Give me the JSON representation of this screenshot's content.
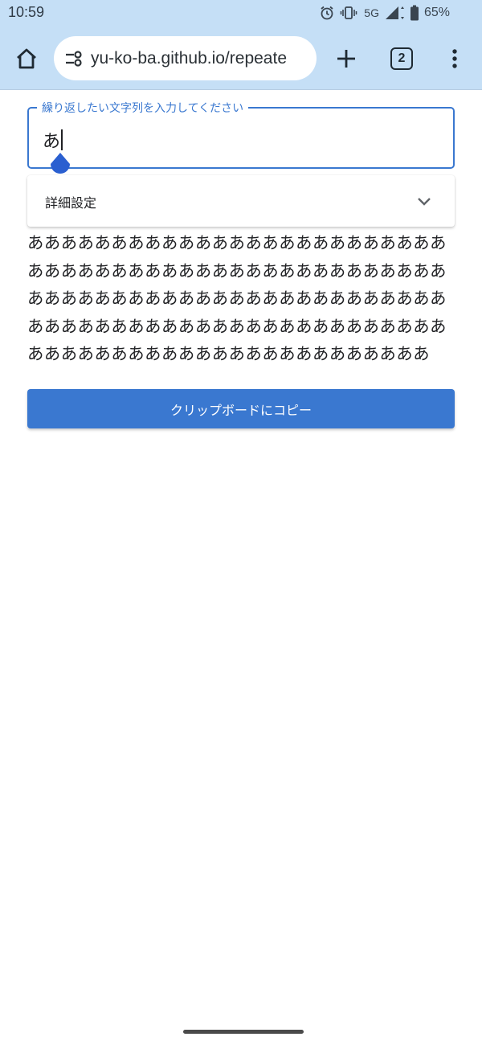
{
  "status_bar": {
    "time": "10:59",
    "network": "5G",
    "battery": "65%",
    "icons": [
      "alarm-icon",
      "vibrate-icon",
      "signal-icon",
      "battery-icon"
    ]
  },
  "browser": {
    "url": "yu-ko-ba.github.io/repeate",
    "tab_count": "2",
    "icons": [
      "home-icon",
      "site-settings-icon",
      "plus-icon",
      "more-vert-icon"
    ]
  },
  "page": {
    "input_label": "繰り返したい文字列を入力してください",
    "input_value": "あ",
    "advanced_label": "詳細設定",
    "output_text": "ああああああああああああああああああああああああああああああああああああああああああああああああああああああああああああああああああああああああああああああああああああああああああああああああああああああああああああああああああああああああああああ",
    "copy_button_label": "クリップボードにコピー"
  },
  "colors": {
    "chrome_bar": "#c5dff6",
    "accent": "#3a78d0",
    "caret_handle": "#2a5fd0"
  }
}
